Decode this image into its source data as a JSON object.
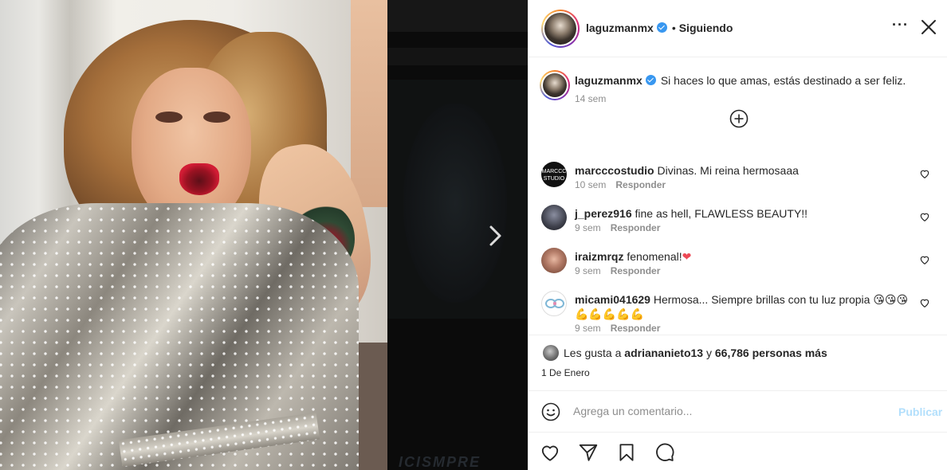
{
  "post": {
    "author": "laguzmanmx",
    "follow_separator": "•",
    "follow_status": "Siguiendo",
    "more_label": "···",
    "caption_author": "laguzmanmx",
    "caption": "Si haces lo que amas, estás destinado a ser feliz.",
    "caption_time": "14 sem"
  },
  "media": {
    "overlay_text": "ICISMPRE"
  },
  "comments": [
    {
      "user": "marcccostudio",
      "text": "Divinas. Mi reina hermosaaa",
      "time": "10 sem",
      "reply": "Responder"
    },
    {
      "user": "j_perez916",
      "text": "fine as hell, FLAWLESS BEAUTY!!",
      "time": "9 sem",
      "reply": "Responder"
    },
    {
      "user": "iraizmrqz",
      "text": "fenomenal!",
      "emoji": "❤",
      "time": "9 sem",
      "reply": "Responder"
    },
    {
      "user": "micami041629",
      "text": "Hermosa... Siempre brillas con tu luz propia",
      "emoji_line1": "😘😘😘",
      "emoji_line2": "💪💪💪💪💪",
      "time": "9 sem",
      "reply": "Responder"
    }
  ],
  "likes": {
    "prefix": "Les gusta a",
    "first_user": "adriananieto13",
    "connector": "y",
    "others": "66,786 personas más",
    "date": "1 De Enero"
  },
  "comment_box": {
    "placeholder": "Agrega un comentario...",
    "publish": "Publicar"
  },
  "colors": {
    "verified": "#3897f0",
    "publish_disabled": "#b2dffc",
    "heart_red": "#ed4956"
  }
}
